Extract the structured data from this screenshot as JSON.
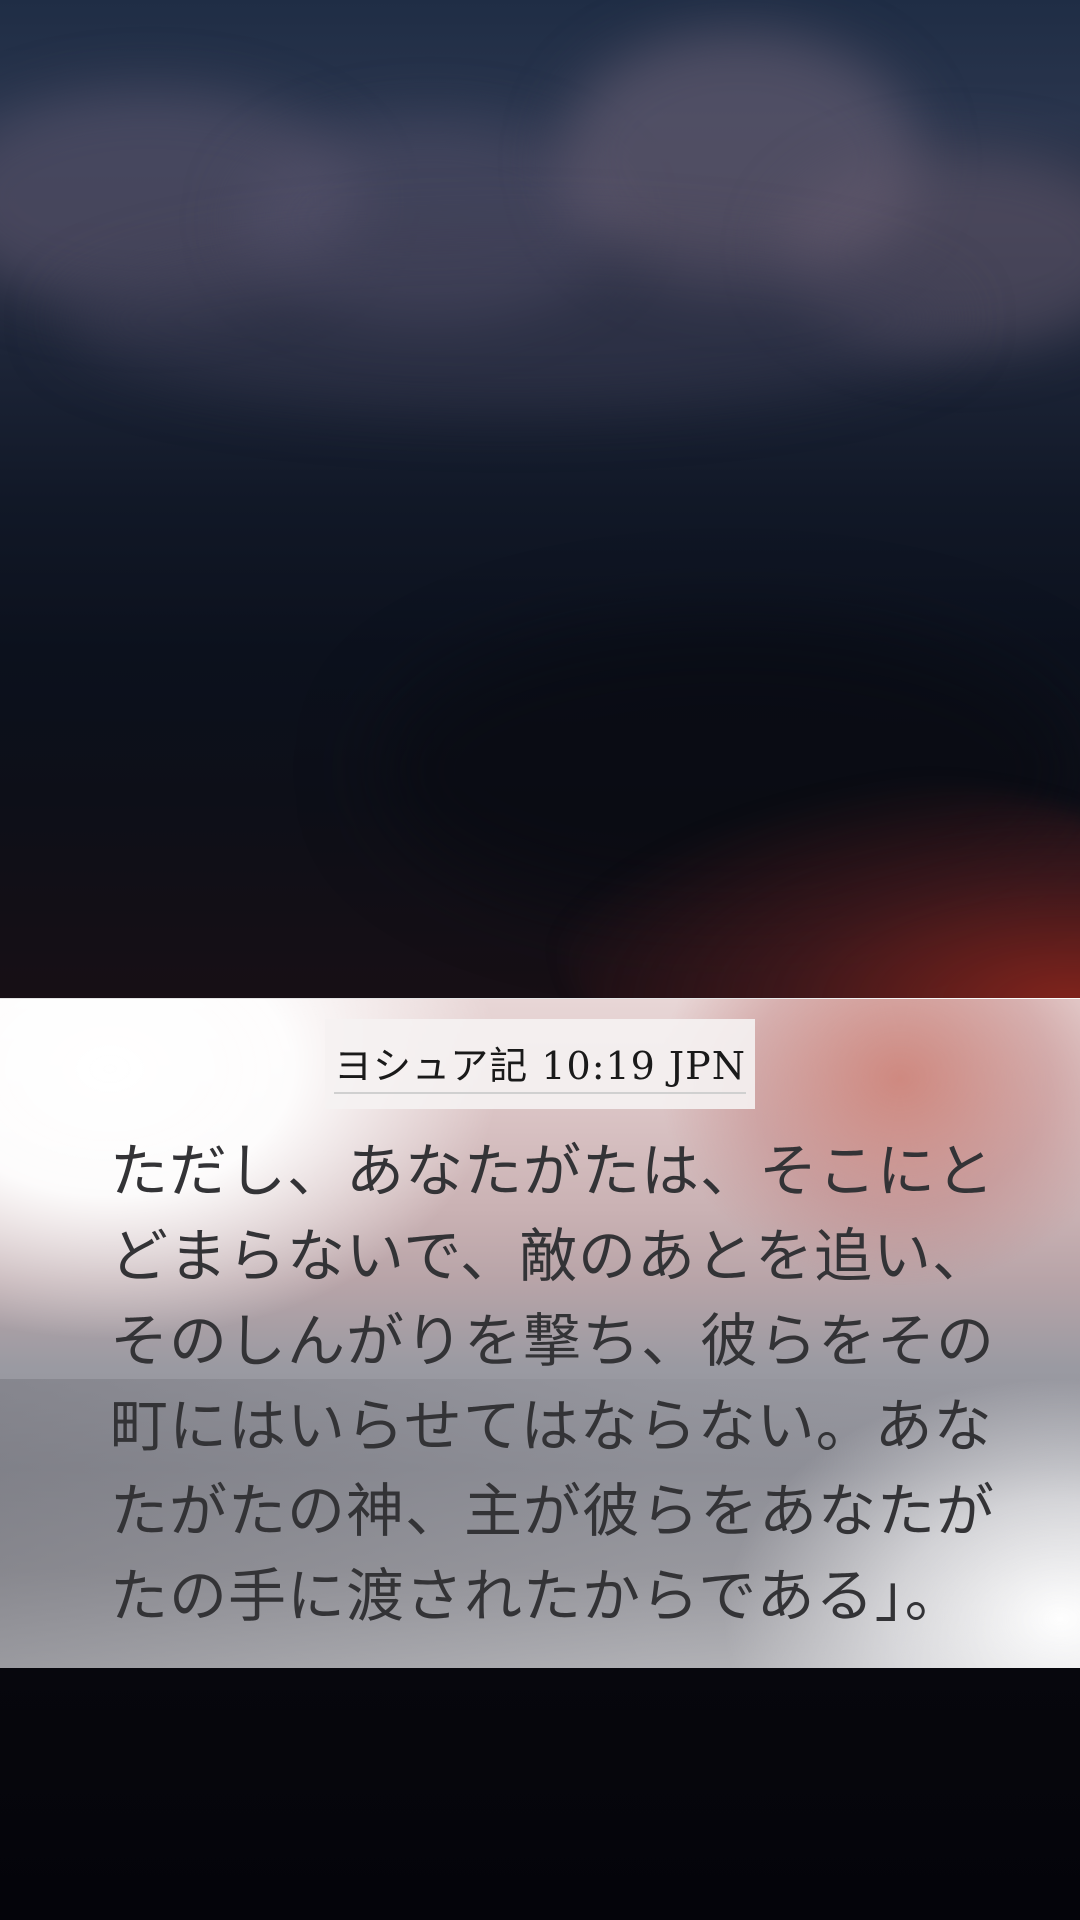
{
  "reference": "ヨシュア記 10:19 JPN",
  "verse_lines": [
    "ただし、あなたがたは、そこにと",
    "どまらないで、敵のあとを追い、",
    "そのしんがりを撃ち、彼らをその",
    "町にはいらせてはならない。あな",
    "たがたの神、主が彼らをあなたが",
    "たの手に渡されたからである」。"
  ],
  "colors": {
    "verse_text": "#333336",
    "reference_text": "#1a1a1a",
    "sky_top": "#1f2d45",
    "sky_glow": "#96281e"
  }
}
